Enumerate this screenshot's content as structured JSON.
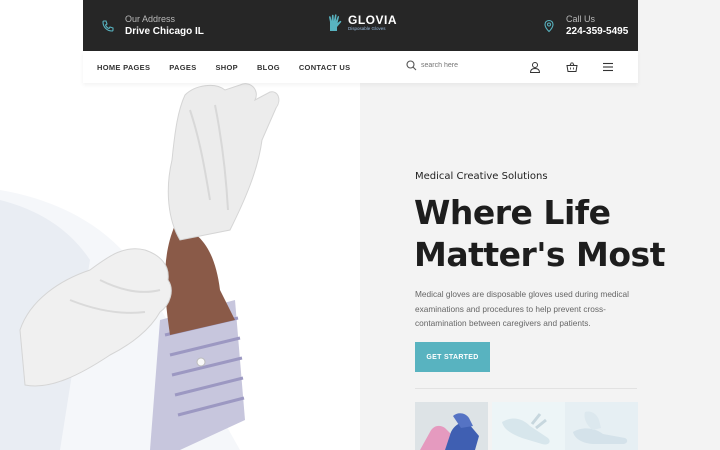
{
  "topbar": {
    "address_label": "Our Address",
    "address_value": "Drive Chicago IL",
    "phone_label": "Call Us",
    "phone_value": "224-359-5495"
  },
  "logo": {
    "name": "GLOVIA",
    "tagline": "Disposable Gloves"
  },
  "nav": {
    "items": [
      "HOME PAGES",
      "PAGES",
      "SHOP",
      "BLOG",
      "CONTACT US"
    ]
  },
  "search": {
    "placeholder": "search here"
  },
  "hero": {
    "eyebrow": "Medical Creative Solutions",
    "headline_line1": "Where Life",
    "headline_line2": "Matter's Most",
    "description": "Medical gloves are disposable gloves used during medical examinations and procedures to help prevent cross-contamination between caregivers and patients.",
    "cta_label": "GET STARTED"
  },
  "colors": {
    "accent": "#58b3c0",
    "topbar": "#262626",
    "hero_right_bg": "#f3f3f3"
  },
  "icons": [
    "phone-icon",
    "location-pin-icon",
    "search-icon",
    "user-icon",
    "basket-icon",
    "menu-icon"
  ]
}
